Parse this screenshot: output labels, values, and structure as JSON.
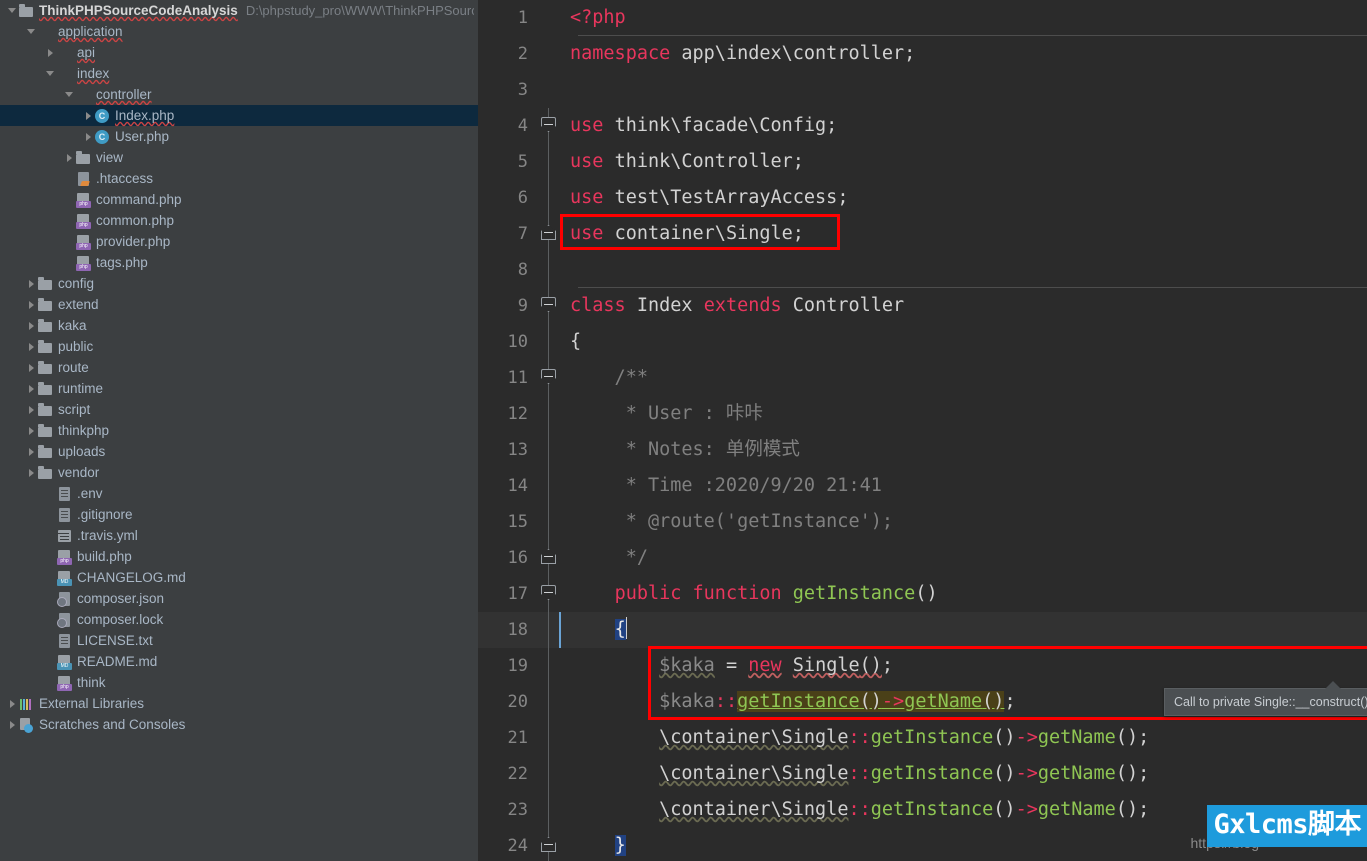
{
  "project": {
    "name": "ThinkPHPSourceCodeAnalysis",
    "path": "D:\\phpstudy_pro\\WWW\\ThinkPHPSourceCo"
  },
  "tree": [
    {
      "label": "ThinkPHPSourceCodeAnalysis",
      "icon": "folder",
      "arrow": "expanded",
      "indent": 0,
      "bold": true,
      "selected": false,
      "squiggle": true,
      "path": "D:\\phpstudy_pro\\WWW\\ThinkPHPSourceCo"
    },
    {
      "label": "application",
      "icon": "folder-blue",
      "arrow": "expanded",
      "indent": 1,
      "bold": false,
      "selected": false,
      "squiggle": true
    },
    {
      "label": "api",
      "icon": "folder-blue",
      "arrow": "collapsed",
      "indent": 2,
      "bold": false,
      "selected": false,
      "squiggle": true
    },
    {
      "label": "index",
      "icon": "folder-blue",
      "arrow": "expanded",
      "indent": 2,
      "bold": false,
      "selected": false,
      "squiggle": true
    },
    {
      "label": "controller",
      "icon": "folder-blue",
      "arrow": "expanded",
      "indent": 3,
      "bold": false,
      "selected": false,
      "squiggle": true
    },
    {
      "label": "Index.php",
      "icon": "classfile",
      "arrow": "collapsed",
      "indent": 4,
      "bold": false,
      "selected": true,
      "squiggle": true
    },
    {
      "label": "User.php",
      "icon": "classfile",
      "arrow": "collapsed",
      "indent": 4,
      "bold": false,
      "selected": false,
      "squiggle": false
    },
    {
      "label": "view",
      "icon": "folder",
      "arrow": "collapsed",
      "indent": 3,
      "bold": false,
      "selected": false,
      "squiggle": false
    },
    {
      "label": ".htaccess",
      "icon": "htaccess",
      "arrow": "none",
      "indent": 3,
      "bold": false,
      "selected": false,
      "squiggle": false
    },
    {
      "label": "command.php",
      "icon": "php",
      "arrow": "none",
      "indent": 3,
      "bold": false,
      "selected": false,
      "squiggle": false
    },
    {
      "label": "common.php",
      "icon": "php",
      "arrow": "none",
      "indent": 3,
      "bold": false,
      "selected": false,
      "squiggle": false
    },
    {
      "label": "provider.php",
      "icon": "php",
      "arrow": "none",
      "indent": 3,
      "bold": false,
      "selected": false,
      "squiggle": false
    },
    {
      "label": "tags.php",
      "icon": "php",
      "arrow": "none",
      "indent": 3,
      "bold": false,
      "selected": false,
      "squiggle": false
    },
    {
      "label": "config",
      "icon": "folder",
      "arrow": "collapsed",
      "indent": 1,
      "bold": false,
      "selected": false,
      "squiggle": false
    },
    {
      "label": "extend",
      "icon": "folder",
      "arrow": "collapsed",
      "indent": 1,
      "bold": false,
      "selected": false,
      "squiggle": false
    },
    {
      "label": "kaka",
      "icon": "folder",
      "arrow": "collapsed",
      "indent": 1,
      "bold": false,
      "selected": false,
      "squiggle": false
    },
    {
      "label": "public",
      "icon": "folder",
      "arrow": "collapsed",
      "indent": 1,
      "bold": false,
      "selected": false,
      "squiggle": false
    },
    {
      "label": "route",
      "icon": "folder",
      "arrow": "collapsed",
      "indent": 1,
      "bold": false,
      "selected": false,
      "squiggle": false
    },
    {
      "label": "runtime",
      "icon": "folder",
      "arrow": "collapsed",
      "indent": 1,
      "bold": false,
      "selected": false,
      "squiggle": false
    },
    {
      "label": "script",
      "icon": "folder",
      "arrow": "collapsed",
      "indent": 1,
      "bold": false,
      "selected": false,
      "squiggle": false
    },
    {
      "label": "thinkphp",
      "icon": "folder",
      "arrow": "collapsed",
      "indent": 1,
      "bold": false,
      "selected": false,
      "squiggle": false
    },
    {
      "label": "uploads",
      "icon": "folder",
      "arrow": "collapsed",
      "indent": 1,
      "bold": false,
      "selected": false,
      "squiggle": false
    },
    {
      "label": "vendor",
      "icon": "folder",
      "arrow": "collapsed",
      "indent": 1,
      "bold": false,
      "selected": false,
      "squiggle": false
    },
    {
      "label": ".env",
      "icon": "file",
      "arrow": "none",
      "indent": 2,
      "bold": false,
      "selected": false,
      "squiggle": false
    },
    {
      "label": ".gitignore",
      "icon": "file",
      "arrow": "none",
      "indent": 2,
      "bold": false,
      "selected": false,
      "squiggle": false
    },
    {
      "label": ".travis.yml",
      "icon": "yml",
      "arrow": "none",
      "indent": 2,
      "bold": false,
      "selected": false,
      "squiggle": false
    },
    {
      "label": "build.php",
      "icon": "php",
      "arrow": "none",
      "indent": 2,
      "bold": false,
      "selected": false,
      "squiggle": false
    },
    {
      "label": "CHANGELOG.md",
      "icon": "md",
      "arrow": "none",
      "indent": 2,
      "bold": false,
      "selected": false,
      "squiggle": false
    },
    {
      "label": "composer.json",
      "icon": "json",
      "arrow": "none",
      "indent": 2,
      "bold": false,
      "selected": false,
      "squiggle": false
    },
    {
      "label": "composer.lock",
      "icon": "json",
      "arrow": "none",
      "indent": 2,
      "bold": false,
      "selected": false,
      "squiggle": false
    },
    {
      "label": "LICENSE.txt",
      "icon": "file",
      "arrow": "none",
      "indent": 2,
      "bold": false,
      "selected": false,
      "squiggle": false
    },
    {
      "label": "README.md",
      "icon": "md",
      "arrow": "none",
      "indent": 2,
      "bold": false,
      "selected": false,
      "squiggle": false
    },
    {
      "label": "think",
      "icon": "php",
      "arrow": "none",
      "indent": 2,
      "bold": false,
      "selected": false,
      "squiggle": false
    },
    {
      "label": "External Libraries",
      "icon": "libs",
      "arrow": "collapsed",
      "indent": 0,
      "bold": false,
      "selected": false,
      "squiggle": false
    },
    {
      "label": "Scratches and Consoles",
      "icon": "scratch",
      "arrow": "collapsed",
      "indent": 0,
      "bold": false,
      "selected": false,
      "squiggle": false
    }
  ],
  "editor": {
    "lines": [
      {
        "n": "1",
        "text": "<?php"
      },
      {
        "n": "2",
        "text": "namespace app\\index\\controller;"
      },
      {
        "n": "3",
        "text": ""
      },
      {
        "n": "4",
        "text": "use think\\facade\\Config;"
      },
      {
        "n": "5",
        "text": "use think\\Controller;"
      },
      {
        "n": "6",
        "text": "use test\\TestArrayAccess;"
      },
      {
        "n": "7",
        "text": "use container\\Single;"
      },
      {
        "n": "8",
        "text": ""
      },
      {
        "n": "9",
        "text": "class Index extends Controller"
      },
      {
        "n": "10",
        "text": "{"
      },
      {
        "n": "11",
        "text": "    /**"
      },
      {
        "n": "12",
        "text": "     * User : 咔咔"
      },
      {
        "n": "13",
        "text": "     * Notes: 单例模式"
      },
      {
        "n": "14",
        "text": "     * Time :2020/9/20 21:41"
      },
      {
        "n": "15",
        "text": "     * @route('getInstance');"
      },
      {
        "n": "16",
        "text": "     */"
      },
      {
        "n": "17",
        "text": "    public function getInstance()"
      },
      {
        "n": "18",
        "text": "    {"
      },
      {
        "n": "19",
        "text": "        $kaka = new Single();"
      },
      {
        "n": "20",
        "text": "        $kaka::getInstance()->getName();"
      },
      {
        "n": "21",
        "text": "        \\container\\Single::getInstance()->getName();"
      },
      {
        "n": "22",
        "text": "        \\container\\Single::getInstance()->getName();"
      },
      {
        "n": "23",
        "text": "        \\container\\Single::getInstance()->getName();"
      },
      {
        "n": "24",
        "text": "    }"
      }
    ]
  },
  "tooltip": {
    "message": "Call to private Single::__construct() from invalid context"
  },
  "watermark": {
    "url": "https://blog",
    "badge": "Gxlcms脚本"
  },
  "colors": {
    "sidebar_bg": "#3c3f41",
    "editor_bg": "#2b2b2b",
    "selection_bg": "#0d293e",
    "annotation_red": "#ff0000",
    "warning_bg": "#4a4018",
    "keyword": "#e8365d",
    "function_green": "#8fc653",
    "comment_grey": "#808080",
    "badge_blue": "#1e9bdc"
  }
}
